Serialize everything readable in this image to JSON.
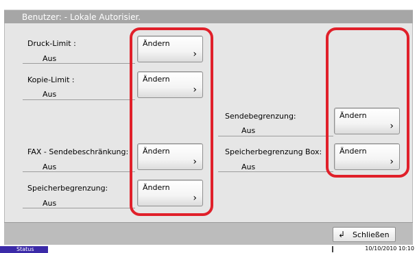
{
  "header": {
    "title": "Benutzer: - Lokale Autorisier."
  },
  "settings": [
    {
      "label": "Druck-Limit :",
      "value": "Aus",
      "button": "Ändern"
    },
    {
      "label": "Kopie-Limit :",
      "value": "Aus",
      "button": "Ändern"
    },
    {
      "label": "FAX - Sendebeschränkung:",
      "value": "Aus",
      "button": "Ändern"
    },
    {
      "label": "Speicherbegrenzung:",
      "value": "Aus",
      "button": "Ändern"
    },
    {
      "label": "Sendebegrenzung:",
      "value": "Aus",
      "button": "Ändern"
    },
    {
      "label": "Speicherbegrenzung Box:",
      "value": "Aus",
      "button": "Ändern"
    }
  ],
  "icons": {
    "chevron": "chevron-right-icon",
    "close": "return-arrow-icon"
  },
  "colors": {
    "highlight": "#e0202a",
    "status_bg": "#3b2aa8"
  },
  "footer": {
    "close_label": "Schließen"
  },
  "statusbar": {
    "status_label": "Status",
    "datetime": "10/10/2010  10:10"
  }
}
